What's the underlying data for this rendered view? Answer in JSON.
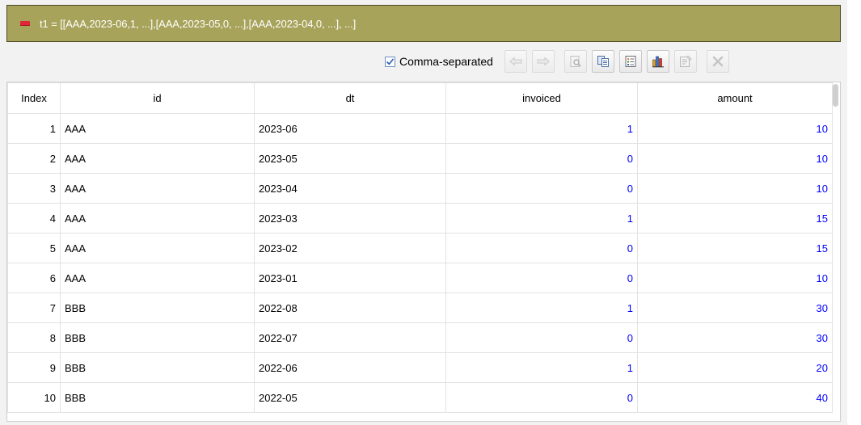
{
  "header": {
    "title": "t1 = [[AAA,2023-06,1, ...],[AAA,2023-05,0, ...],[AAA,2023-04,0, ...], ...]"
  },
  "toolbar": {
    "comma_separated_label": "Comma-separated",
    "comma_separated_checked": true,
    "buttons": [
      "arrow-left-icon",
      "arrow-right-icon",
      "preview-icon",
      "copy-icon",
      "list-icon",
      "chart-icon",
      "properties-icon",
      "close-icon"
    ]
  },
  "table": {
    "columns": [
      "Index",
      "id",
      "dt",
      "invoiced",
      "amount"
    ],
    "rows": [
      {
        "index": "1",
        "id": "AAA",
        "dt": "2023-06",
        "invoiced": "1",
        "amount": "10"
      },
      {
        "index": "2",
        "id": "AAA",
        "dt": "2023-05",
        "invoiced": "0",
        "amount": "10"
      },
      {
        "index": "3",
        "id": "AAA",
        "dt": "2023-04",
        "invoiced": "0",
        "amount": "10"
      },
      {
        "index": "4",
        "id": "AAA",
        "dt": "2023-03",
        "invoiced": "1",
        "amount": "15"
      },
      {
        "index": "5",
        "id": "AAA",
        "dt": "2023-02",
        "invoiced": "0",
        "amount": "15"
      },
      {
        "index": "6",
        "id": "AAA",
        "dt": "2023-01",
        "invoiced": "0",
        "amount": "10"
      },
      {
        "index": "7",
        "id": "BBB",
        "dt": "2022-08",
        "invoiced": "1",
        "amount": "30"
      },
      {
        "index": "8",
        "id": "BBB",
        "dt": "2022-07",
        "invoiced": "0",
        "amount": "30"
      },
      {
        "index": "9",
        "id": "BBB",
        "dt": "2022-06",
        "invoiced": "1",
        "amount": "20"
      },
      {
        "index": "10",
        "id": "BBB",
        "dt": "2022-05",
        "invoiced": "0",
        "amount": "40"
      }
    ]
  },
  "colors": {
    "header_bg": "#a7a35a",
    "number_text": "#0000ff"
  }
}
